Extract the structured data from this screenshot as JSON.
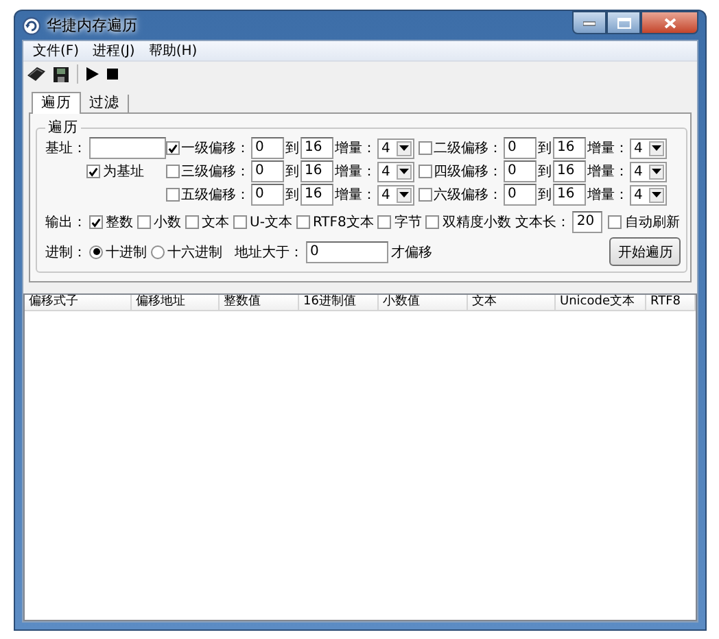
{
  "window": {
    "title": "华捷内存遍历"
  },
  "menu": [
    {
      "label": "文件(F)"
    },
    {
      "label": "进程(J)"
    },
    {
      "label": "帮助(H)"
    }
  ],
  "tabs": [
    {
      "label": "遍历",
      "selected": true
    },
    {
      "label": "过滤",
      "selected": false
    }
  ],
  "group": {
    "title": "遍历",
    "base_label": "基址：",
    "as_base": {
      "label": "为基址",
      "checked": true
    }
  },
  "offsets": [
    {
      "label": "一级偏移：",
      "checked": true,
      "from": "0",
      "to_label": "到",
      "to": "16",
      "step_label": "增量：",
      "step": "4"
    },
    {
      "label": "二级偏移：",
      "checked": false,
      "from": "0",
      "to_label": "到",
      "to": "16",
      "step_label": "增量：",
      "step": "4"
    },
    {
      "label": "三级偏移：",
      "checked": false,
      "from": "0",
      "to_label": "到",
      "to": "16",
      "step_label": "增量：",
      "step": "4"
    },
    {
      "label": "四级偏移：",
      "checked": false,
      "from": "0",
      "to_label": "到",
      "to": "16",
      "step_label": "增量：",
      "step": "4"
    },
    {
      "label": "五级偏移：",
      "checked": false,
      "from": "0",
      "to_label": "到",
      "to": "16",
      "step_label": "增量：",
      "step": "4"
    },
    {
      "label": "六级偏移：",
      "checked": false,
      "from": "0",
      "to_label": "到",
      "to": "16",
      "step_label": "增量：",
      "step": "4"
    }
  ],
  "output": {
    "label": "输出：",
    "options": [
      {
        "label": "整数",
        "checked": true
      },
      {
        "label": "小数",
        "checked": false
      },
      {
        "label": "文本",
        "checked": false
      },
      {
        "label": "U-文本",
        "checked": false
      },
      {
        "label": "RTF8文本",
        "checked": false
      },
      {
        "label": "字节",
        "checked": false
      },
      {
        "label": "双精度小数",
        "checked": false
      }
    ],
    "text_length_label": "文本长：",
    "text_length": "20",
    "auto_refresh": {
      "label": "自动刷新",
      "checked": false
    }
  },
  "radix": {
    "label": "进制：",
    "options": [
      {
        "label": "十进制",
        "selected": true
      },
      {
        "label": "十六进制",
        "selected": false
      }
    ],
    "address_label": "地址大于：",
    "address_value": "0",
    "address_suffix": "才偏移"
  },
  "start_button": "开始遍历",
  "list": {
    "columns": [
      "偏移式子",
      "偏移地址",
      "整数值",
      "16进制值",
      "小数值",
      "文本",
      "Unicode文本",
      "RTF8"
    ]
  }
}
